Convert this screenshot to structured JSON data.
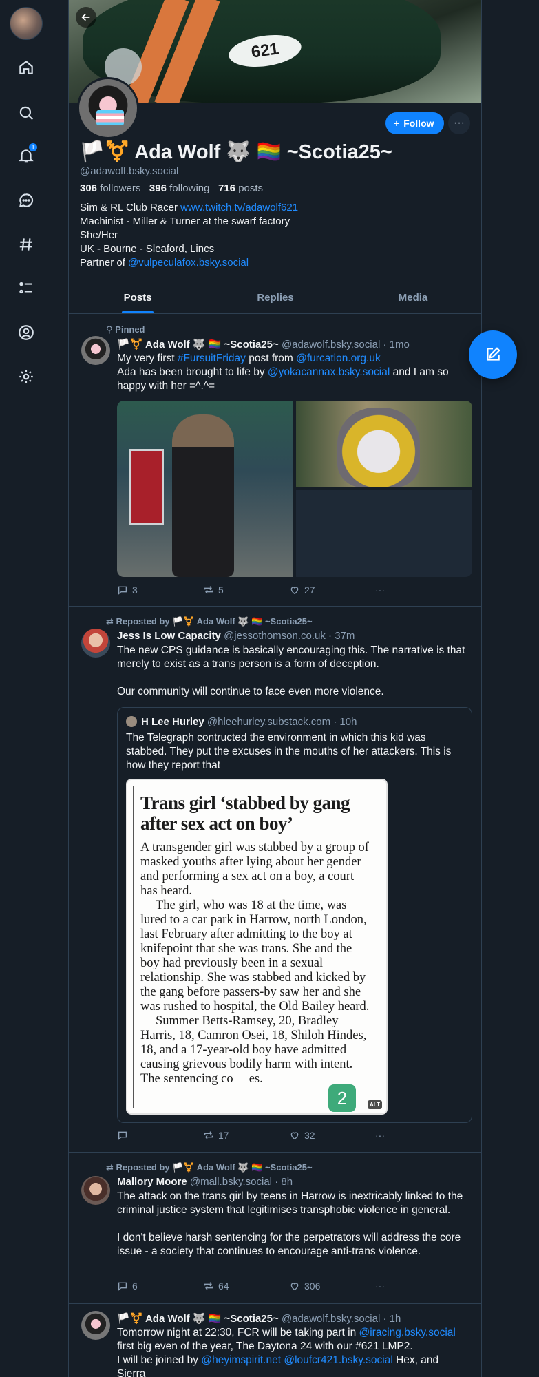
{
  "nav": {
    "items": [
      "home-icon",
      "search-icon",
      "notifications-icon",
      "chat-icon",
      "feeds-icon",
      "lists-icon",
      "profile-icon",
      "settings-icon"
    ],
    "notification_count": "1"
  },
  "profile": {
    "display_name": "🏳️⚧️ Ada Wolf 🐺 🏳️‍🌈 ~Scotia25~",
    "handle": "@adawolf.bsky.social",
    "followers_count": "306",
    "followers_label": "followers",
    "following_count": "396",
    "following_label": "following",
    "posts_count": "716",
    "posts_label": "posts",
    "bio": {
      "line1_text": "Sim & RL Club Racer ",
      "line1_link": "www.twitch.tv/adawolf621",
      "line2": "Machinist - Miller & Turner at the swarf factory",
      "line3": "She/Her",
      "line4": "UK - Bourne - Sleaford, Lincs",
      "line5_text": "Partner of ",
      "line5_link": "@vulpeculafox.bsky.social"
    },
    "follow_label": "Follow",
    "banner_number": "621"
  },
  "tabs": [
    "Posts",
    "Replies",
    "Media"
  ],
  "posts": [
    {
      "context": "Pinned",
      "author": "🏳️⚧️ Ada Wolf 🐺 🏳️‍🌈 ~Scotia25~",
      "handle": "@adawolf.bsky.social",
      "time": "· 1mo",
      "text": {
        "a": "My very first ",
        "hashtag": "#FursuitFriday",
        "b": " post from ",
        "mention1": "@furcation.org.uk",
        "c": "Ada has been brought to life by ",
        "mention2": "@yokacannax.bsky.social",
        "d": " and I am so happy with her =^.^="
      },
      "replies": "3",
      "reposts": "5",
      "likes": "27"
    },
    {
      "context": "Reposted by 🏳️⚧️ Ada Wolf 🐺 🏳️‍🌈 ~Scotia25~",
      "author": "Jess Is Low Capacity",
      "handle": "@jessothomson.co.uk",
      "time": "· 37m",
      "text1": "The new CPS guidance is basically encouraging this. The narrative is that merely to exist as a trans person is a form of deception.",
      "text2": "Our community will continue to face even more violence.",
      "quote": {
        "author": "H Lee Hurley",
        "handle": "@hleehurley.substack.com",
        "time": "· 10h",
        "text": "The Telegraph contructed the environment in which this kid was stabbed. They put the excuses in the mouths of her attackers. This is how they report that",
        "headline": "Trans girl ‘stabbed by gang after sex act on boy’",
        "article_p1": "A transgender girl was stabbed by a group of masked youths after lying about her gender and performing a sex act on a boy, a court has heard.",
        "article_p2": "The girl, who was 18 at the time, was lured to a car park in Harrow, north London, last February after admitting to the boy at knifepoint that she was trans. She and the boy had previously been in a sexual relationship. She was stabbed and kicked by the gang before passers-by saw her and she was rushed to hospital, the Old Bailey heard.",
        "article_p3": "Summer Betts-Ramsey, 20, Bradley Harris, 18, Camron Osei, 18, Shiloh Hindes, 18, and a 17-year-old boy have admitted causing grievous bodily harm with intent. The sentencing co",
        "article_p3_end": "es.",
        "bubble_number": "2",
        "alt": "ALT"
      },
      "replies": "",
      "reposts": "17",
      "likes": "32"
    },
    {
      "context": "Reposted by 🏳️⚧️ Ada Wolf 🐺 🏳️‍🌈 ~Scotia25~",
      "author": "Mallory Moore",
      "handle": "@mall.bsky.social",
      "time": "· 8h",
      "text1": "The attack on the trans girl by teens in Harrow is inextricably linked to the criminal justice system that legitimises transphobic violence in general.",
      "text2": "I don't believe harsh sentencing for the perpetrators will address the core issue - a society that continues to encourage anti-trans violence.",
      "replies": "6",
      "reposts": "64",
      "likes": "306"
    },
    {
      "author": "🏳️⚧️ Ada Wolf 🐺 🏳️‍🌈 ~Scotia25~",
      "handle": "@adawolf.bsky.social",
      "time": "· 1h",
      "text": {
        "a": "Tomorrow night at 22:30, FCR will be taking part in ",
        "mention1": "@iracing.bsky.social",
        "b": "first big even of the year, The Daytona 24 with our #621 LMP2.",
        "c": "I will be joined by ",
        "mention2": "@heyimspirit.net",
        "mention3": "@loufcr421.bsky.social",
        "d": " Hex, and",
        "e": "Sierra"
      }
    }
  ],
  "colors": {
    "accent": "#1083fe",
    "link": "#208bfe",
    "background": "#161e27",
    "border": "#2e4052",
    "muted": "#8c9fb4"
  }
}
